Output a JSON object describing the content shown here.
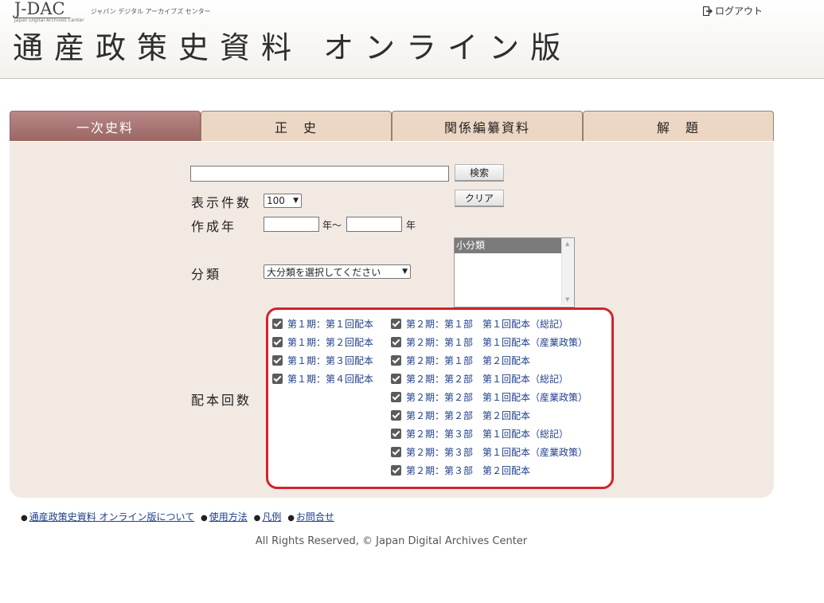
{
  "header": {
    "logo": "J-DAC",
    "logo_sub": "Japan Digital Archives Center",
    "logo_text": "ジャパン デジタル アーカイブズ センター",
    "title": "通産政策史資料 オンライン版",
    "logout": "ログアウト"
  },
  "tabs": [
    {
      "label": "一次史料"
    },
    {
      "label": "正　史"
    },
    {
      "label": "関係編纂資料"
    },
    {
      "label": "解　題"
    }
  ],
  "search": {
    "keyword_value": "",
    "search_button": "検索",
    "clear_button": "クリア",
    "count_label": "表示件数",
    "count_value": "100",
    "year_label": "作成年",
    "year_from_suffix": "年〜",
    "year_to_suffix": "年",
    "category_label": "分類",
    "category_value": "大分類を選択してください",
    "subcategory_option": "小分類",
    "issue_label": "配本回数"
  },
  "issues": {
    "left": [
      "第１期：第１回配本",
      "第１期：第２回配本",
      "第１期：第３回配本",
      "第１期：第４回配本"
    ],
    "right": [
      "第２期：第１部　第１回配本（総記）",
      "第２期：第１部　第１回配本（産業政策）",
      "第２期：第１部　第２回配本",
      "第２期：第２部　第１回配本（総記）",
      "第２期：第２部　第１回配本（産業政策）",
      "第２期：第２部　第２回配本",
      "第２期：第３部　第１回配本（総記）",
      "第２期：第３部　第１回配本（産業政策）",
      "第２期：第３部　第２回配本"
    ]
  },
  "footer": {
    "links": [
      "通産政策史資料 オンライン版について",
      "使用方法",
      "凡例",
      "お問合せ"
    ],
    "bullet": "●",
    "copyright": "All Rights Reserved, © Japan Digital Archives Center"
  }
}
